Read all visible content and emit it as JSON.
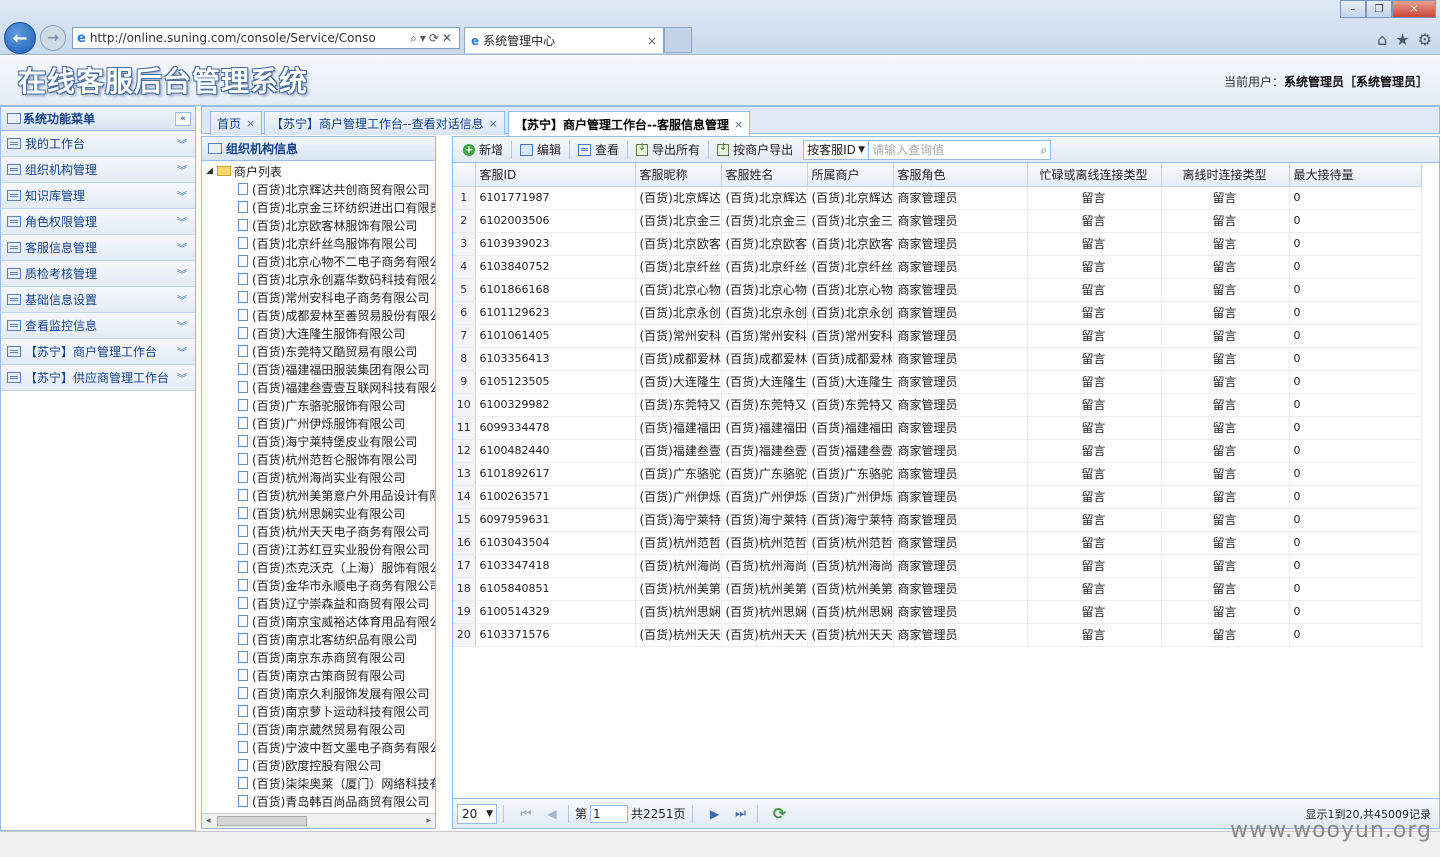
{
  "browser": {
    "url": "http://online.suning.com/console/Service/Conso",
    "tab_title": "系统管理中心",
    "tab_close": "×"
  },
  "header": {
    "title": "在线客服后台管理系统",
    "user_label": "当前用户：",
    "user_name": "系统管理员［系统管理员］"
  },
  "menu": {
    "title": "系统功能菜单",
    "items": [
      "我的工作台",
      "组织机构管理",
      "知识库管理",
      "角色权限管理",
      "客服信息管理",
      "质检考核管理",
      "基础信息设置",
      "查看监控信息",
      "【苏宁】商户管理工作台",
      "【苏宁】供应商管理工作台"
    ]
  },
  "tabs": [
    {
      "label": "首页",
      "close": "×"
    },
    {
      "label": "【苏宁】商户管理工作台--查看对话信息",
      "close": "×"
    },
    {
      "label": "【苏宁】商户管理工作台--客服信息管理",
      "close": "×"
    }
  ],
  "tree": {
    "title": "组织机构信息",
    "root": "商户列表",
    "items": [
      "(百货)北京辉达共创商贸有限公司",
      "(百货)北京金三环纺织进出口有限责",
      "(百货)北京欧客林服饰有限公司",
      "(百货)北京纤丝鸟服饰有限公司",
      "(百货)北京心物不二电子商务有限公",
      "(百货)北京永创嘉华数码科技有限公",
      "(百货)常州安科电子商务有限公司",
      "(百货)成都爱林至善贸易股份有限公",
      "(百货)大连隆生服饰有限公司",
      "(百货)东莞特又酷贸易有限公司",
      "(百货)福建福田服装集团有限公司",
      "(百货)福建叁壹壹互联网科技有限公",
      "(百货)广东骆驼服饰有限公司",
      "(百货)广州伊烁服饰有限公司",
      "(百货)海宁莱特堡皮业有限公司",
      "(百货)杭州范哲仑服饰有限公司",
      "(百货)杭州海尚实业有限公司",
      "(百货)杭州美第意户外用品设计有限",
      "(百货)杭州思娴实业有限公司",
      "(百货)杭州天天电子商务有限公司",
      "(百货)江苏红豆实业股份有限公司",
      "(百货)杰克沃克（上海）服饰有限公",
      "(百货)金华市永顺电子商务有限公司",
      "(百货)辽宁崇森益和商贸有限公司",
      "(百货)南京宝威裕达体育用品有限公",
      "(百货)南京北客纺织品有限公司",
      "(百货)南京东赤商贸有限公司",
      "(百货)南京古策商贸有限公司",
      "(百货)南京久利服饰发展有限公司",
      "(百货)南京萝卜运动科技有限公司",
      "(百货)南京葳然贸易有限公司",
      "(百货)宁波中哲文墨电子商务有限公",
      "(百货)欧度控股有限公司",
      "(百货)柒柒奥莱（厦门）网络科技有",
      "(百货)青岛韩百尚品商贸有限公司"
    ]
  },
  "toolbar": {
    "add": "新增",
    "edit": "编辑",
    "view": "查看",
    "export_all": "导出所有",
    "export_merchant": "按商户导出",
    "search_field": "按客服ID",
    "search_placeholder": "请输入查询值"
  },
  "grid": {
    "columns": [
      "客服ID",
      "客服昵称",
      "客服姓名",
      "所属商户",
      "客服角色",
      "忙碌或离线连接类型",
      "离线时连接类型",
      "最大接待量"
    ],
    "rows": [
      [
        "1",
        "6101771987",
        "(百货)北京辉达",
        "(百货)北京辉达",
        "(百货)北京辉达",
        "商家管理员",
        "留言",
        "留言",
        "0"
      ],
      [
        "2",
        "6102003506",
        "(百货)北京金三",
        "(百货)北京金三",
        "(百货)北京金三",
        "商家管理员",
        "留言",
        "留言",
        "0"
      ],
      [
        "3",
        "6103939023",
        "(百货)北京欧客",
        "(百货)北京欧客",
        "(百货)北京欧客",
        "商家管理员",
        "留言",
        "留言",
        "0"
      ],
      [
        "4",
        "6103840752",
        "(百货)北京纤丝",
        "(百货)北京纤丝",
        "(百货)北京纤丝",
        "商家管理员",
        "留言",
        "留言",
        "0"
      ],
      [
        "5",
        "6101866168",
        "(百货)北京心物",
        "(百货)北京心物",
        "(百货)北京心物",
        "商家管理员",
        "留言",
        "留言",
        "0"
      ],
      [
        "6",
        "6101129623",
        "(百货)北京永创",
        "(百货)北京永创",
        "(百货)北京永创",
        "商家管理员",
        "留言",
        "留言",
        "0"
      ],
      [
        "7",
        "6101061405",
        "(百货)常州安科",
        "(百货)常州安科",
        "(百货)常州安科",
        "商家管理员",
        "留言",
        "留言",
        "0"
      ],
      [
        "8",
        "6103356413",
        "(百货)成都爱林",
        "(百货)成都爱林",
        "(百货)成都爱林",
        "商家管理员",
        "留言",
        "留言",
        "0"
      ],
      [
        "9",
        "6105123505",
        "(百货)大连隆生",
        "(百货)大连隆生",
        "(百货)大连隆生",
        "商家管理员",
        "留言",
        "留言",
        "0"
      ],
      [
        "10",
        "6100329982",
        "(百货)东莞特又",
        "(百货)东莞特又",
        "(百货)东莞特又",
        "商家管理员",
        "留言",
        "留言",
        "0"
      ],
      [
        "11",
        "6099334478",
        "(百货)福建福田",
        "(百货)福建福田",
        "(百货)福建福田",
        "商家管理员",
        "留言",
        "留言",
        "0"
      ],
      [
        "12",
        "6100482440",
        "(百货)福建叁壹",
        "(百货)福建叁壹",
        "(百货)福建叁壹",
        "商家管理员",
        "留言",
        "留言",
        "0"
      ],
      [
        "13",
        "6101892617",
        "(百货)广东骆驼",
        "(百货)广东骆驼",
        "(百货)广东骆驼",
        "商家管理员",
        "留言",
        "留言",
        "0"
      ],
      [
        "14",
        "6100263571",
        "(百货)广州伊烁",
        "(百货)广州伊烁",
        "(百货)广州伊烁",
        "商家管理员",
        "留言",
        "留言",
        "0"
      ],
      [
        "15",
        "6097959631",
        "(百货)海宁莱特",
        "(百货)海宁莱特",
        "(百货)海宁莱特",
        "商家管理员",
        "留言",
        "留言",
        "0"
      ],
      [
        "16",
        "6103043504",
        "(百货)杭州范哲",
        "(百货)杭州范哲",
        "(百货)杭州范哲",
        "商家管理员",
        "留言",
        "留言",
        "0"
      ],
      [
        "17",
        "6103347418",
        "(百货)杭州海尚",
        "(百货)杭州海尚",
        "(百货)杭州海尚",
        "商家管理员",
        "留言",
        "留言",
        "0"
      ],
      [
        "18",
        "6105840851",
        "(百货)杭州美第",
        "(百货)杭州美第",
        "(百货)杭州美第",
        "商家管理员",
        "留言",
        "留言",
        "0"
      ],
      [
        "19",
        "6100514329",
        "(百货)杭州思娴",
        "(百货)杭州思娴",
        "(百货)杭州思娴",
        "商家管理员",
        "留言",
        "留言",
        "0"
      ],
      [
        "20",
        "6103371576",
        "(百货)杭州天天",
        "(百货)杭州天天",
        "(百货)杭州天天",
        "商家管理员",
        "留言",
        "留言",
        "0"
      ]
    ]
  },
  "pager": {
    "page_size": "20",
    "page_label": "第",
    "page_value": "1",
    "total_pages": "共2251页",
    "info": "显示1到20,共45009记录"
  },
  "watermark": "www.wooyun.org"
}
